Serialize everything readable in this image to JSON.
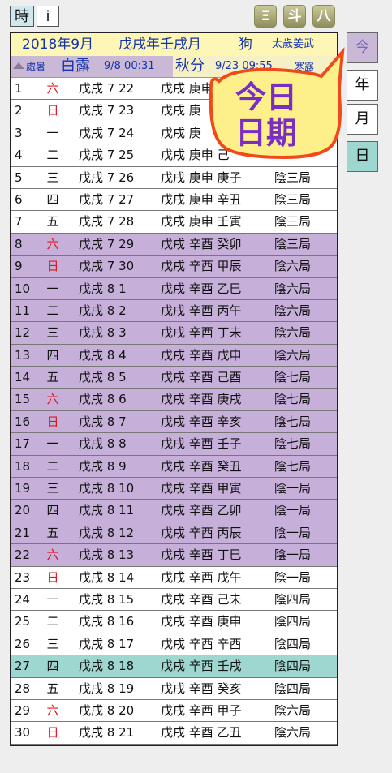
{
  "toolbar": {
    "hour_label": "時",
    "info_label": "i",
    "icons": [
      {
        "name": "qimen-icon",
        "glyph": "Ξ"
      },
      {
        "name": "doushu-icon",
        "glyph": "斗"
      },
      {
        "name": "bazi-icon",
        "glyph": "八"
      }
    ]
  },
  "header": {
    "solar_month": "2018年9月",
    "ganzhi_month": "戊戌年壬戌月",
    "zodiac": "狗",
    "tai_sui": "太歲姜武"
  },
  "jieqi_bar": {
    "prev_label": "處暑",
    "current_name": "白露",
    "current_time": "9/8 00:31",
    "next_name": "秋分",
    "next_time": "9/23 09:55",
    "next2_label": "寒露"
  },
  "side": {
    "today_label": "今",
    "year_label": "年",
    "month_label": "月",
    "day_label": "日"
  },
  "callout": {
    "line1": "今日",
    "line2": "日期"
  },
  "colors": {
    "purple_row": "#c6afd9",
    "teal_row": "#9ed7cf",
    "header_blue": "#1433b0",
    "weekday_red": "#e0141e",
    "callout_yellow": "#fdf08a",
    "callout_border": "#f04a1a",
    "callout_text": "#7a2ec1"
  },
  "rows": [
    {
      "day": "1",
      "wd": "六",
      "red": true,
      "lunar": "戊戌 7 22",
      "gz": "戊戌 庚申 ",
      "ju": "",
      "hl": ""
    },
    {
      "day": "2",
      "wd": "日",
      "red": true,
      "lunar": "戊戌 7 23",
      "gz": "戊戌 庚",
      "ju": "",
      "hl": ""
    },
    {
      "day": "3",
      "wd": "一",
      "red": false,
      "lunar": "戊戌 7 24",
      "gz": "戊戌 庚",
      "ju": "",
      "hl": ""
    },
    {
      "day": "4",
      "wd": "二",
      "red": false,
      "lunar": "戊戌 7 25",
      "gz": "戊戌 庚申 己",
      "ju": "",
      "hl": ""
    },
    {
      "day": "5",
      "wd": "三",
      "red": false,
      "lunar": "戊戌 7 26",
      "gz": "戊戌 庚申 庚子",
      "ju": "陰三局",
      "hl": ""
    },
    {
      "day": "6",
      "wd": "四",
      "red": false,
      "lunar": "戊戌 7 27",
      "gz": "戊戌 庚申 辛丑",
      "ju": "陰三局",
      "hl": ""
    },
    {
      "day": "7",
      "wd": "五",
      "red": false,
      "lunar": "戊戌 7 28",
      "gz": "戊戌 庚申 壬寅",
      "ju": "陰三局",
      "hl": ""
    },
    {
      "day": "8",
      "wd": "六",
      "red": true,
      "lunar": "戊戌 7 29",
      "gz": "戊戌 辛酉 癸卯",
      "ju": "陰三局",
      "hl": "purple"
    },
    {
      "day": "9",
      "wd": "日",
      "red": true,
      "lunar": "戊戌 7 30",
      "gz": "戊戌 辛酉 甲辰",
      "ju": "陰六局",
      "hl": "purple"
    },
    {
      "day": "10",
      "wd": "一",
      "red": false,
      "lunar": "戊戌 8 1",
      "gz": "戊戌 辛酉 乙巳",
      "ju": "陰六局",
      "hl": "purple"
    },
    {
      "day": "11",
      "wd": "二",
      "red": false,
      "lunar": "戊戌 8 2",
      "gz": "戊戌 辛酉 丙午",
      "ju": "陰六局",
      "hl": "purple"
    },
    {
      "day": "12",
      "wd": "三",
      "red": false,
      "lunar": "戊戌 8 3",
      "gz": "戊戌 辛酉 丁未",
      "ju": "陰六局",
      "hl": "purple"
    },
    {
      "day": "13",
      "wd": "四",
      "red": false,
      "lunar": "戊戌 8 4",
      "gz": "戊戌 辛酉 戊申",
      "ju": "陰六局",
      "hl": "purple"
    },
    {
      "day": "14",
      "wd": "五",
      "red": false,
      "lunar": "戊戌 8 5",
      "gz": "戊戌 辛酉 己酉",
      "ju": "陰七局",
      "hl": "purple"
    },
    {
      "day": "15",
      "wd": "六",
      "red": true,
      "lunar": "戊戌 8 6",
      "gz": "戊戌 辛酉 庚戌",
      "ju": "陰七局",
      "hl": "purple"
    },
    {
      "day": "16",
      "wd": "日",
      "red": true,
      "lunar": "戊戌 8 7",
      "gz": "戊戌 辛酉 辛亥",
      "ju": "陰七局",
      "hl": "purple"
    },
    {
      "day": "17",
      "wd": "一",
      "red": false,
      "lunar": "戊戌 8 8",
      "gz": "戊戌 辛酉 壬子",
      "ju": "陰七局",
      "hl": "purple"
    },
    {
      "day": "18",
      "wd": "二",
      "red": false,
      "lunar": "戊戌 8 9",
      "gz": "戊戌 辛酉 癸丑",
      "ju": "陰七局",
      "hl": "purple"
    },
    {
      "day": "19",
      "wd": "三",
      "red": false,
      "lunar": "戊戌 8 10",
      "gz": "戊戌 辛酉 甲寅",
      "ju": "陰一局",
      "hl": "purple"
    },
    {
      "day": "20",
      "wd": "四",
      "red": false,
      "lunar": "戊戌 8 11",
      "gz": "戊戌 辛酉 乙卯",
      "ju": "陰一局",
      "hl": "purple"
    },
    {
      "day": "21",
      "wd": "五",
      "red": false,
      "lunar": "戊戌 8 12",
      "gz": "戊戌 辛酉 丙辰",
      "ju": "陰一局",
      "hl": "purple"
    },
    {
      "day": "22",
      "wd": "六",
      "red": true,
      "lunar": "戊戌 8 13",
      "gz": "戊戌 辛酉 丁巳",
      "ju": "陰一局",
      "hl": "purple"
    },
    {
      "day": "23",
      "wd": "日",
      "red": true,
      "lunar": "戊戌 8 14",
      "gz": "戊戌 辛酉 戊午",
      "ju": "陰一局",
      "hl": ""
    },
    {
      "day": "24",
      "wd": "一",
      "red": false,
      "lunar": "戊戌 8 15",
      "gz": "戊戌 辛酉 己未",
      "ju": "陰四局",
      "hl": ""
    },
    {
      "day": "25",
      "wd": "二",
      "red": false,
      "lunar": "戊戌 8 16",
      "gz": "戊戌 辛酉 庚申",
      "ju": "陰四局",
      "hl": ""
    },
    {
      "day": "26",
      "wd": "三",
      "red": false,
      "lunar": "戊戌 8 17",
      "gz": "戊戌 辛酉 辛酉",
      "ju": "陰四局",
      "hl": ""
    },
    {
      "day": "27",
      "wd": "四",
      "red": false,
      "lunar": "戊戌 8 18",
      "gz": "戊戌 辛酉 壬戌",
      "ju": "陰四局",
      "hl": "teal"
    },
    {
      "day": "28",
      "wd": "五",
      "red": false,
      "lunar": "戊戌 8 19",
      "gz": "戊戌 辛酉 癸亥",
      "ju": "陰四局",
      "hl": ""
    },
    {
      "day": "29",
      "wd": "六",
      "red": true,
      "lunar": "戊戌 8 20",
      "gz": "戊戌 辛酉 甲子",
      "ju": "陰六局",
      "hl": ""
    },
    {
      "day": "30",
      "wd": "日",
      "red": true,
      "lunar": "戊戌 8 21",
      "gz": "戊戌 辛酉 乙丑",
      "ju": "陰六局",
      "hl": ""
    }
  ]
}
